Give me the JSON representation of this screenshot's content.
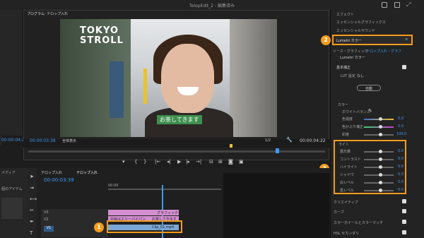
{
  "window": {
    "title": "TelopEdit_2 - 編集済み"
  },
  "program": {
    "tab1": "プログラム: テロップ入れ",
    "timecode": "00:00:03:39",
    "fit": "全体表示",
    "ratio": "1/2",
    "duration": "00:00:04:22",
    "left_duration": "00:00:04:22",
    "video_logo": "TOKYO\nSTROLL",
    "video_subtitle": "お茶してきます"
  },
  "effects_panel": {
    "items": [
      "エフェクト",
      "エッセンシャルグラフィックス",
      "エッセンシャルサウンド"
    ],
    "lumetri_label": "Lumetri カラー",
    "source_master": "ソース・グラフィック",
    "source_clip": "テロップ入れ・グラフ",
    "lumetri_sub": "Lumetri カラー",
    "basic_correction": "基本補正",
    "lut_label": "LUT 設定",
    "lut_value": "なし",
    "auto_label": "自動",
    "color_header": "カラー",
    "wb_label": "ホワイトバランス",
    "color_rows": [
      {
        "label": "色温度",
        "value": "0.0"
      },
      {
        "label": "色かぶり補正",
        "value": "0.0"
      },
      {
        "label": "彩度",
        "value": "100.0"
      }
    ],
    "light_header": "ライト",
    "light_rows": [
      {
        "label": "露光量",
        "value": "0.0"
      },
      {
        "label": "コントラスト",
        "value": "0.0"
      },
      {
        "label": "ハイライト",
        "value": "0.0"
      },
      {
        "label": "シャドウ",
        "value": "0.0"
      },
      {
        "label": "白レベル",
        "value": "0.0"
      },
      {
        "label": "黒レベル",
        "value": "0.0"
      }
    ],
    "bottom_sections": [
      "クリエイティブ",
      "カーブ",
      "カラーホイールとカラーマッチ",
      "HSL セカンダリ"
    ]
  },
  "timeline": {
    "tab_a": "テロップ入れ",
    "tab_b": "テロップ入れ",
    "timecode": "00:00:03:39",
    "ruler_start": "00:00",
    "clip_graphic": "グラフィック",
    "clip_text": "中目はエリーパイパン",
    "clip_text2": "お茶してきます",
    "clip_video": "Clip_01.mp4"
  },
  "left_panel": {
    "label1": "メディア",
    "label2": "個のアイテム"
  },
  "badges": [
    "1",
    "2",
    "3"
  ],
  "colors": {
    "accent": "#f29c1e",
    "timecode": "#3c9bf5",
    "panel": "#232323",
    "subtitle_bg": "#3e8f4d"
  }
}
